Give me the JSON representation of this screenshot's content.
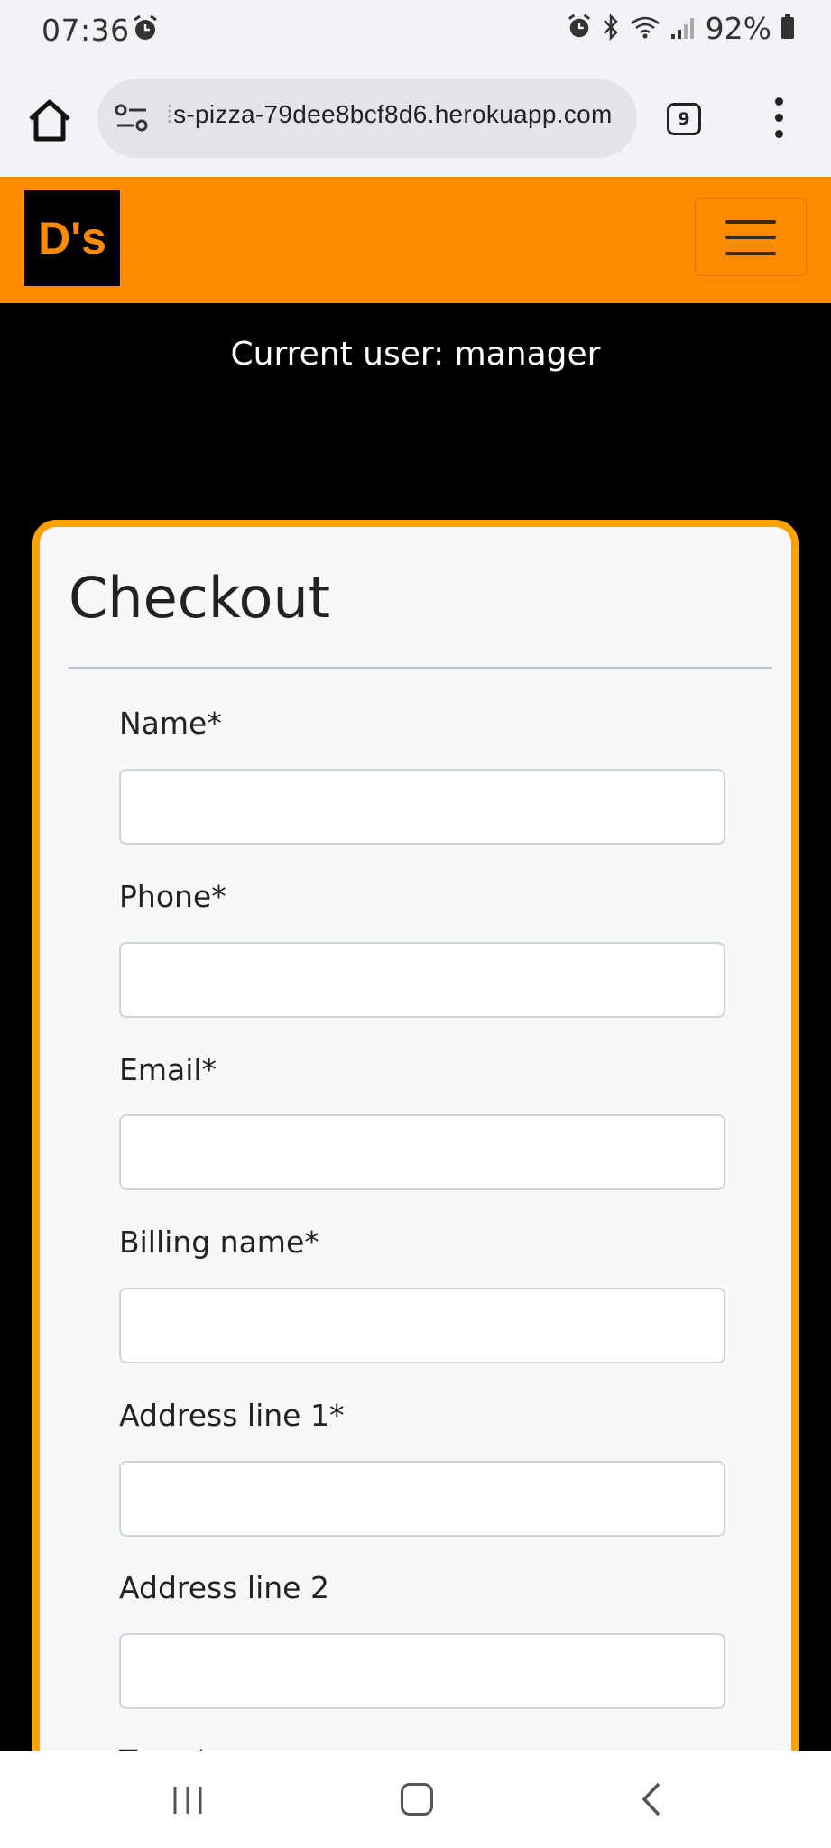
{
  "status_bar": {
    "time": "07:36",
    "battery_percent": "92%"
  },
  "browser": {
    "url_faded": "⁞",
    "url": "s-pizza-79dee8bcf8d6.herokuapp.com",
    "tab_count": "9"
  },
  "site": {
    "logo_text": "D's",
    "current_user": "Current user: manager",
    "colors": {
      "brand": "#ff8c00",
      "card_border": "#ffa100",
      "page_bg": "#000000"
    }
  },
  "checkout": {
    "title": "Checkout",
    "fields": [
      {
        "label": "Name*",
        "value": ""
      },
      {
        "label": "Phone*",
        "value": ""
      },
      {
        "label": "Email*",
        "value": ""
      },
      {
        "label": "Billing name*",
        "value": ""
      },
      {
        "label": "Address line 1*",
        "value": ""
      },
      {
        "label": "Address line 2",
        "value": ""
      },
      {
        "label": "Town*",
        "value": ""
      }
    ]
  }
}
